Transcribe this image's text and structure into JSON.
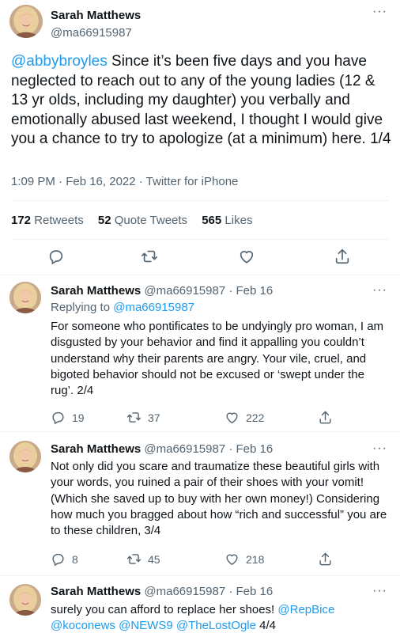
{
  "main_tweet": {
    "author_name": "Sarah Matthews",
    "handle": "@ma66915987",
    "mention": "@abbybroyles",
    "text": " Since it’s been five days and you have neglected to reach out to any of the young ladies (12 & 13 yr olds, including my daughter) you verbally and emotionally abused last weekend, I thought I would give you a chance to try to apologize (at a minimum) here. 1/4",
    "meta": "1:09 PM · Feb 16, 2022 · Twitter for iPhone",
    "retweets_count": "172",
    "retweets_label": "Retweets",
    "quotes_count": "52",
    "quotes_label": "Quote Tweets",
    "likes_count": "565",
    "likes_label": "Likes"
  },
  "replies": [
    {
      "name": "Sarah Matthews",
      "handle_date": "@ma66915987 · Feb 16",
      "replying_prefix": "Replying to ",
      "replying_to": "@ma66915987",
      "text": "For someone who pontificates to be undyingly pro woman, I am disgusted by your behavior and find it appalling you couldn’t understand why their parents are angry.  Your vile, cruel, and bigoted behavior should not be excused or ‘swept under the rug’. 2/4",
      "replies": "19",
      "retweets": "37",
      "likes": "222"
    },
    {
      "name": "Sarah Matthews",
      "handle_date": "@ma66915987 · Feb 16",
      "text": "Not only did you scare and traumatize these beautiful girls with your words, you ruined a pair of their shoes with your vomit! (Which she saved up to buy with her own money!) Considering how much you bragged about how “rich and successful” you are to these children, 3/4",
      "replies": "8",
      "retweets": "45",
      "likes": "218"
    },
    {
      "name": "Sarah Matthews",
      "handle_date": "@ma66915987 · Feb 16",
      "text_prefix": "surely you can afford to replace her shoes!  ",
      "mention_a": "@RepBice",
      "mention_b": "@koconews",
      "mention_c": "@NEWS9",
      "mention_d": "@TheLostOgle",
      "text_suffix": " 4/4"
    }
  ],
  "colors": {
    "link": "#1d9bf0",
    "secondary_text": "#536471",
    "divider": "#eff3f4"
  }
}
